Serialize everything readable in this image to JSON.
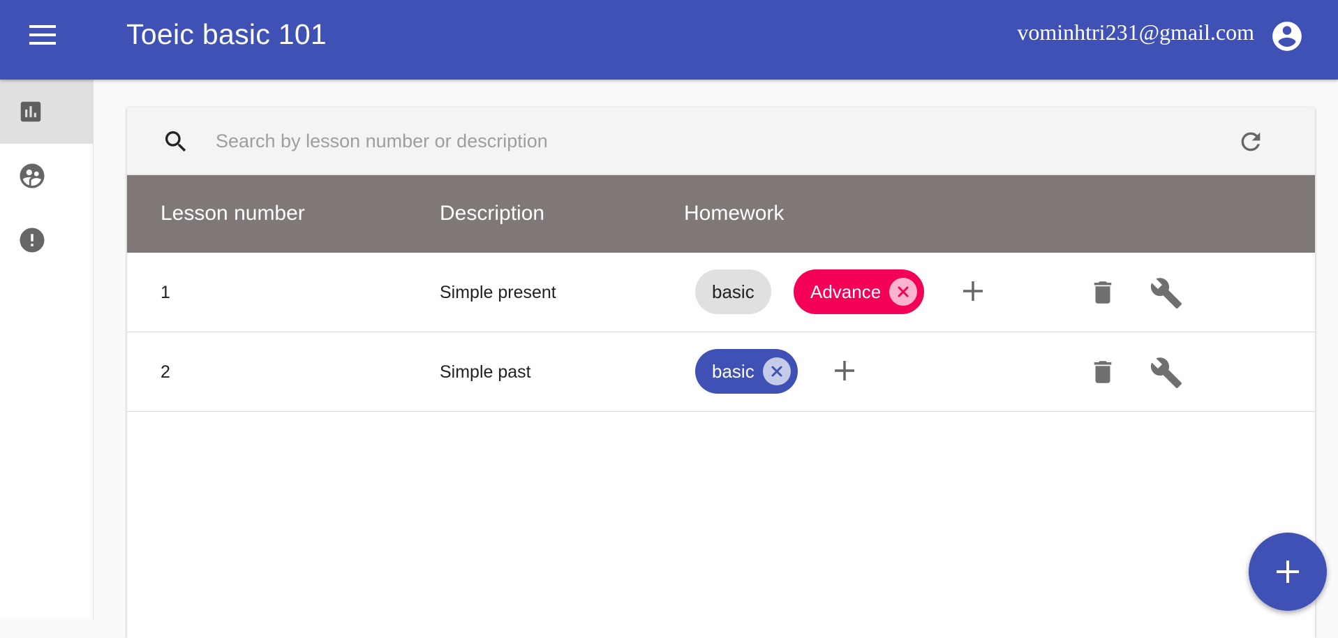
{
  "appbar": {
    "title": "Toeic basic 101",
    "user_email": "vominhtri231@gmail.com",
    "color": "#3f51b5"
  },
  "sidebar": {
    "items": [
      {
        "icon": "bar-chart-icon",
        "active": true
      },
      {
        "icon": "group-icon",
        "active": false
      },
      {
        "icon": "alert-icon",
        "active": false
      }
    ]
  },
  "search": {
    "placeholder": "Search by lesson number or description",
    "value": ""
  },
  "table": {
    "headers": {
      "lesson_number": "Lesson number",
      "description": "Description",
      "homework": "Homework"
    },
    "rows": [
      {
        "lesson_number": "1",
        "description": "Simple present",
        "homework": [
          {
            "label": "basic",
            "style": "default",
            "removable": false
          },
          {
            "label": "Advance",
            "style": "secondary",
            "removable": true
          }
        ]
      },
      {
        "lesson_number": "2",
        "description": "Simple past",
        "homework": [
          {
            "label": "basic",
            "style": "primary",
            "removable": true
          }
        ]
      }
    ]
  },
  "colors": {
    "primary": "#3f51b5",
    "secondary": "#f50057",
    "table_header": "#807877"
  }
}
